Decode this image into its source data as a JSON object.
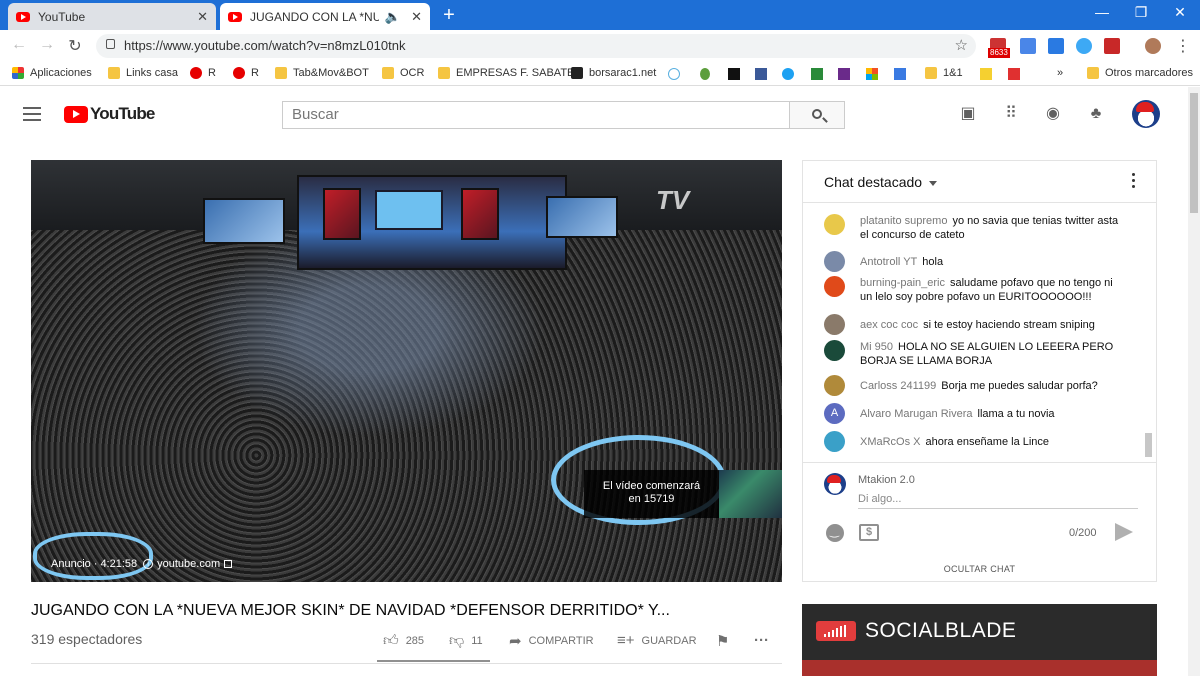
{
  "browser": {
    "tabs": [
      {
        "label": "YouTube",
        "active": false
      },
      {
        "label": "JUGANDO CON LA *NUEVA",
        "active": true
      }
    ],
    "new_tab": "+",
    "window_controls": {
      "minimize": "—",
      "restore": "❐",
      "close": "✕"
    },
    "url": "https://www.youtube.com/watch?v=n8mzL010tnk",
    "gmail_badge": "8633"
  },
  "bookmarks": [
    {
      "label": "Aplicaciones",
      "icon": "apps-grid-icon"
    },
    {
      "label": "Links casa",
      "icon": "folder-icon"
    },
    {
      "label": "R",
      "icon": "vodafone-icon"
    },
    {
      "label": "R",
      "icon": "vodafone-icon"
    },
    {
      "label": "Tab&Mov&BOT",
      "icon": "folder-icon"
    },
    {
      "label": "OCR",
      "icon": "folder-icon"
    },
    {
      "label": "EMPRESAS F. SABATE",
      "icon": "folder-icon"
    },
    {
      "label": "borsarac1.net",
      "icon": "site-icon"
    },
    {
      "label": "1&1",
      "icon": "folder-icon"
    },
    {
      "label": "Otros marcadores",
      "icon": "folder-icon"
    }
  ],
  "bookmarks_overflow": "»",
  "youtube": {
    "logo_text": "YouTube",
    "search_placeholder": "Buscar"
  },
  "video": {
    "ad_label": "Anuncio",
    "ad_time": "4:21:58",
    "ad_domain": "youtube.com",
    "skip_text_line1": "El vídeo comenzará",
    "skip_text_line2": "en 15719",
    "overlay_brand": "TV",
    "title": "JUGANDO CON LA *NUEVA MEJOR SKIN* DE NAVIDAD *DEFENSOR DERRITIDO* Y...",
    "viewers": "319 espectadores",
    "likes": "285",
    "dislikes": "11",
    "share_label": "COMPARTIR",
    "save_label": "GUARDAR"
  },
  "chat": {
    "title": "Chat destacado",
    "messages": [
      {
        "author": "platanito supremo",
        "text": "yo no savia que tenias twitter asta el concurso de cateto",
        "avatar_color": "#e8c84a"
      },
      {
        "author": "Antotroll YT",
        "text": "hola",
        "avatar_color": "#7a8aa8"
      },
      {
        "author": "burning-pain_eric",
        "text": "saludame pofavo que no tengo ni un lelo soy pobre pofavo un EURITOOOOOO!!!",
        "avatar_color": "#e04a1a"
      },
      {
        "author": "aex coc coc",
        "text": "si te estoy haciendo stream sniping",
        "avatar_color": "#8a7a6a"
      },
      {
        "author": "Mi 950",
        "text": "HOLA NO SE ALGUIEN LO LEEERA PERO BORJA SE LLAMA BORJA",
        "avatar_color": "#1a4a3a"
      },
      {
        "author": "Carloss 241199",
        "text": "Borja me puedes saludar porfa?",
        "avatar_color": "#b08a3a"
      },
      {
        "author": "Alvaro Marugan Rivera",
        "text": "llama a tu novia",
        "avatar_color": "#5c6bc0"
      },
      {
        "author": "XMaRcOs X",
        "text": "ahora enseñame la Lince",
        "avatar_color": "#3aa0c8"
      }
    ],
    "alvaro_initial": "A",
    "composer_name": "Mtakion 2.0",
    "composer_placeholder": "Di algo...",
    "char_count": "0/200",
    "hide_label": "OCULTAR CHAT"
  },
  "socialblade": {
    "name": "SOCIALBLADE"
  }
}
